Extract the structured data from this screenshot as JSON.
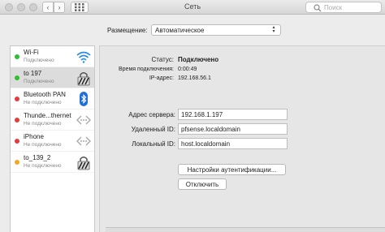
{
  "window": {
    "title": "Сеть"
  },
  "toolbar": {
    "back_glyph": "‹",
    "forward_glyph": "›",
    "search_placeholder": "Поиск"
  },
  "location": {
    "label": "Размещение:",
    "value": "Автоматическое"
  },
  "services": [
    {
      "name": "Wi-Fi",
      "status": "Подключено",
      "dot_color": "#2fc12f",
      "icon": "wifi-icon"
    },
    {
      "name": "to 197",
      "status": "Подключено",
      "dot_color": "#2fc12f",
      "icon": "vpn-lock-icon"
    },
    {
      "name": "Bluetooth PAN",
      "status": "Не подключено",
      "dot_color": "#e63b3b",
      "icon": "bluetooth-icon"
    },
    {
      "name": "Thunde...thernet",
      "status": "Не подключено",
      "dot_color": "#e63b3b",
      "icon": "ethernet-icon"
    },
    {
      "name": "iPhone",
      "status": "Не подключено",
      "dot_color": "#e63b3b",
      "icon": "ethernet-icon"
    },
    {
      "name": "to_139_2",
      "status": "Не подключено",
      "dot_color": "#f5a623",
      "icon": "vpn-lock-icon"
    }
  ],
  "details": {
    "status_label": "Статус:",
    "status_value": "Подключено",
    "time_label": "Время подключения:",
    "time_value": "0:00:49",
    "ip_label": "IP-адрес:",
    "ip_value": "192.168.56.1",
    "server_label": "Адрес сервера:",
    "server_value": "192.168.1.197",
    "remote_label": "Удаленный ID:",
    "remote_value": "pfsense.localdomain",
    "local_label": "Локальный ID:",
    "local_value": "host.localdomain",
    "auth_button": "Настройки аутентификации...",
    "disconnect_button": "Отключить"
  }
}
